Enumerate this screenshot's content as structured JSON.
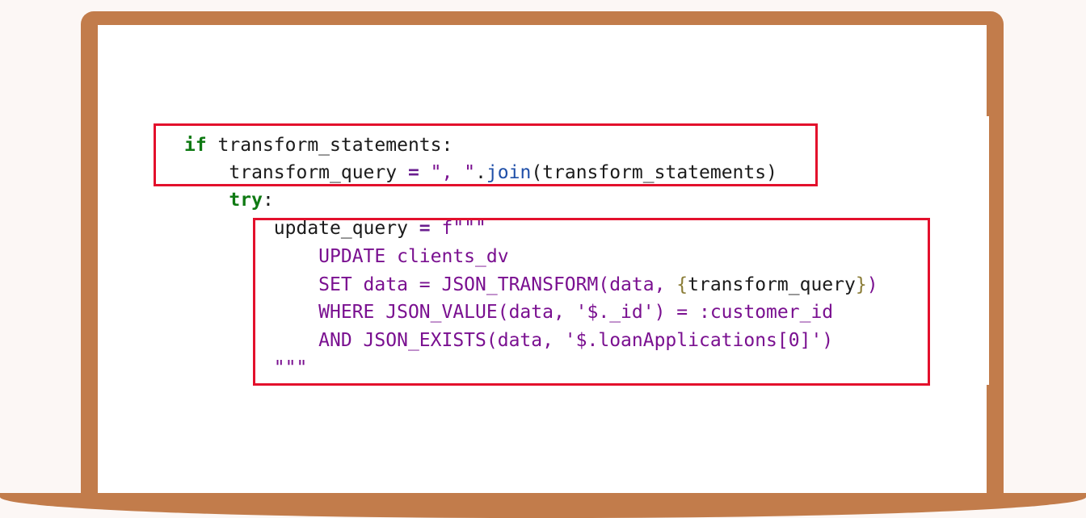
{
  "code": {
    "line1": {
      "keyword": "if",
      "rest": " transform_statements:"
    },
    "line2": {
      "indent": "    ",
      "var": "transform_query ",
      "op": "=",
      "string": " \", \"",
      "dot": ".",
      "func": "join",
      "args": "(transform_statements)"
    },
    "line3": {
      "indent": "    ",
      "keyword": "try",
      "rest": ":"
    },
    "line4": {
      "indent": "        ",
      "var": "update_query ",
      "op": "=",
      "rest": " f\"\"\""
    },
    "line5": {
      "indent": "            ",
      "sql": "UPDATE clients_dv"
    },
    "line6": {
      "indent": "            ",
      "sql": "SET data = JSON_TRANSFORM(data, ",
      "brace_open": "{",
      "interp": "transform_query",
      "brace_close": "}",
      "close": ")"
    },
    "line7": {
      "indent": "            ",
      "sql": "WHERE JSON_VALUE(data, '$._id') = :customer_id"
    },
    "line8": {
      "indent": "            ",
      "sql": "AND JSON_EXISTS(data, '$.loanApplications[0]')"
    },
    "line9": {
      "indent": "        ",
      "close": "\"\"\""
    }
  },
  "colors": {
    "highlight": "#e3102c",
    "laptop": "#c27c4b",
    "keyword": "#0f7a13",
    "string": "#7a1090",
    "function": "#1f4fa8"
  }
}
